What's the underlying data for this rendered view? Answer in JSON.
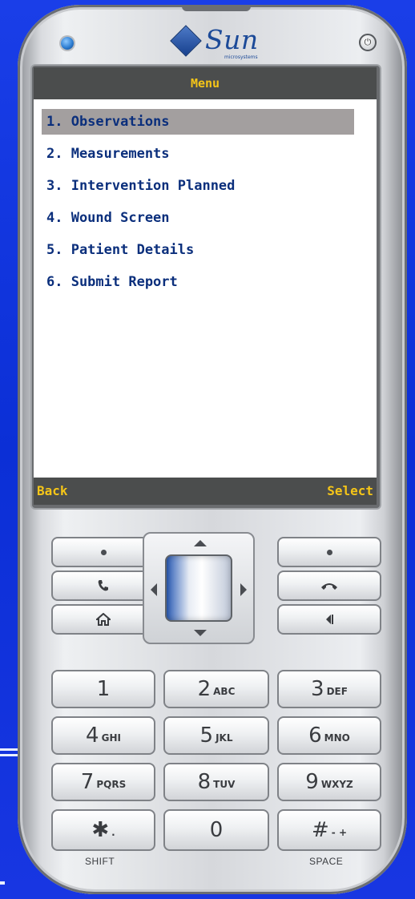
{
  "device": {
    "brand": "Sun",
    "brand_sub": "microsystems"
  },
  "screen": {
    "title": "Menu",
    "menu_items": [
      "1. Observations",
      "2. Measurements",
      "3. Intervention Planned",
      "4. Wound Screen",
      "5. Patient Details",
      "6. Submit Report"
    ],
    "selected_index": 0,
    "softkeys": {
      "left": "Back",
      "right": "Select"
    }
  },
  "keypad": {
    "keys": [
      {
        "num": "1",
        "sub": ""
      },
      {
        "num": "2",
        "sub": "ABC"
      },
      {
        "num": "3",
        "sub": "DEF"
      },
      {
        "num": "4",
        "sub": "GHI"
      },
      {
        "num": "5",
        "sub": "JKL"
      },
      {
        "num": "6",
        "sub": "MNO"
      },
      {
        "num": "7",
        "sub": "PQRS"
      },
      {
        "num": "8",
        "sub": "TUV"
      },
      {
        "num": "9",
        "sub": "WXYZ"
      },
      {
        "num": "✱",
        "sub": "."
      },
      {
        "num": "0",
        "sub": ""
      },
      {
        "num": "#",
        "sub": "- +"
      }
    ],
    "shift_label": "SHIFT",
    "space_label": "SPACE"
  },
  "colors": {
    "background": "#0b2fd6",
    "title_text": "#f5c518",
    "menu_text": "#0b2f7c",
    "selection": "#a39f9f",
    "bar": "#4b4d4d"
  },
  "icons": {
    "call": "phone-call-icon",
    "end": "phone-end-icon",
    "home": "home-icon",
    "back": "backspace-icon",
    "power": "power-icon",
    "led": "status-led-icon"
  }
}
